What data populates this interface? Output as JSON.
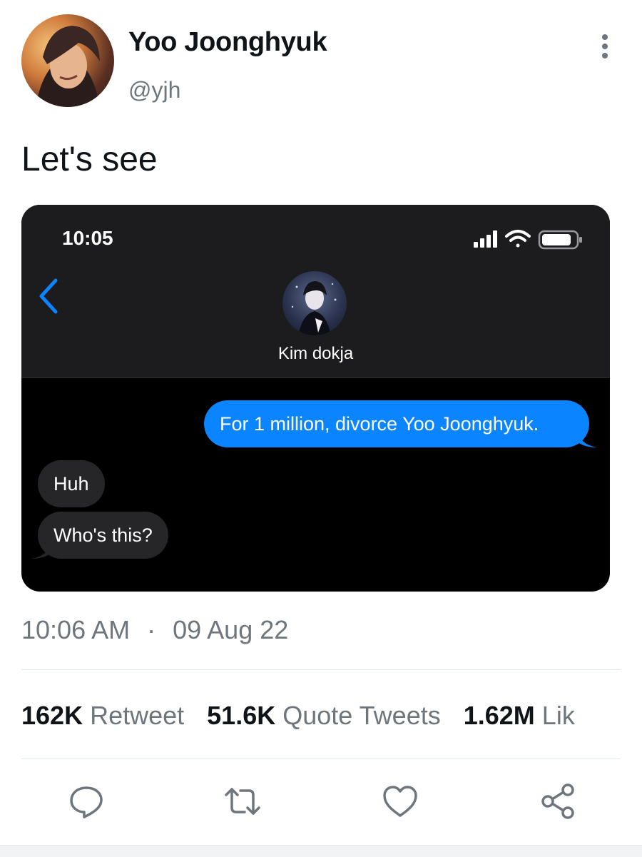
{
  "tweet": {
    "author_name": "Yoo Joonghyuk",
    "author_handle": "@yjh",
    "text": "Let's see",
    "time": "10:06 AM",
    "separator": "·",
    "date": "09 Aug 22"
  },
  "stats": {
    "retweets_count": "162K",
    "retweets_label": "Retweet",
    "quotes_count": "51.6K",
    "quotes_label": "Quote Tweets",
    "likes_count": "1.62M",
    "likes_label": "Lik"
  },
  "embedded_screenshot": {
    "clock": "10:05",
    "contact_name": "Kim dokja",
    "messages": [
      {
        "direction": "outgoing",
        "text": "For 1 million, divorce Yoo Joonghyuk."
      },
      {
        "direction": "incoming",
        "text": "Huh"
      },
      {
        "direction": "incoming",
        "text": "Who's this?"
      }
    ]
  },
  "icons": {
    "more": "more-vertical-icon",
    "reply": "reply-icon",
    "retweet": "retweet-icon",
    "like": "heart-icon",
    "share": "share-icon"
  },
  "colors": {
    "imessage_blue": "#0a84ff",
    "incoming_bubble": "#262629",
    "secondary_text": "#6e767d",
    "divider": "#e1e8ed"
  }
}
